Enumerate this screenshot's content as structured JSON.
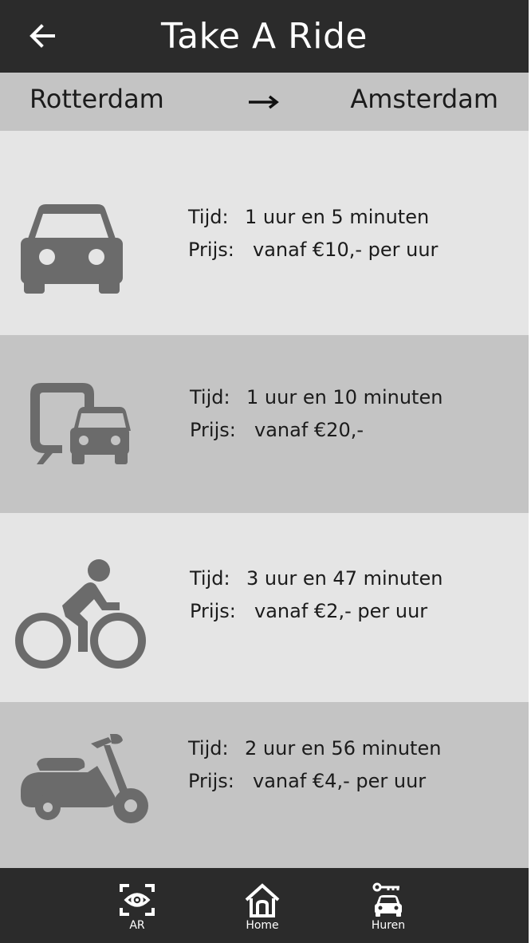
{
  "header": {
    "title": "Take A Ride",
    "back_icon": "arrow-left-icon"
  },
  "route": {
    "from": "Rotterdam",
    "to": "Amsterdam",
    "arrow_icon": "arrow-right-icon"
  },
  "options": [
    {
      "icon": "car-icon",
      "tijd_label": "Tijd:",
      "tijd": "1 uur en 5 minuten",
      "prijs_label": "Prijs:",
      "prijs": "vanaf €10,- per uur"
    },
    {
      "icon": "public-transport-car-icon",
      "tijd_label": "Tijd:",
      "tijd": "1 uur en 10 minuten",
      "prijs_label": "Prijs:",
      "prijs": "vanaf €20,-"
    },
    {
      "icon": "bicycle-icon",
      "tijd_label": "Tijd:",
      "tijd": "3 uur en 47 minuten",
      "prijs_label": "Prijs:",
      "prijs": "vanaf €2,- per uur"
    },
    {
      "icon": "scooter-icon",
      "tijd_label": "Tijd:",
      "tijd": "2 uur en 56 minuten",
      "prijs_label": "Prijs:",
      "prijs": "vanaf €4,- per uur"
    }
  ],
  "nav": [
    {
      "label": "AR",
      "icon": "ar-eye-icon"
    },
    {
      "label": "Home",
      "icon": "home-icon"
    },
    {
      "label": "Huren",
      "icon": "car-key-icon"
    }
  ],
  "colors": {
    "header_bg": "#2b2b2b",
    "band_dark": "#c4c4c4",
    "band_light": "#e5e5e5",
    "icon_grey": "#6b6b6b"
  }
}
